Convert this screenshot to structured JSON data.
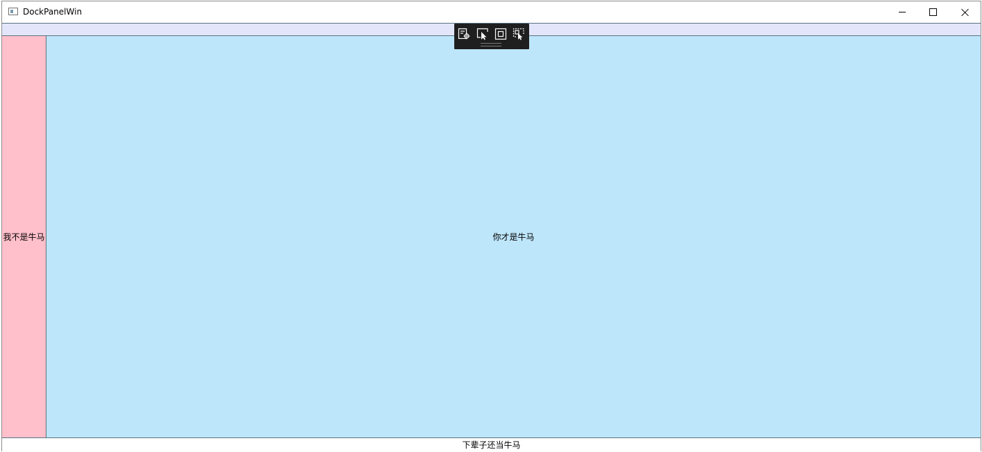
{
  "window": {
    "title": "DockPanelWin",
    "app_icon": "window-app-icon",
    "buttons": {
      "minimize": "minimize-icon",
      "maximize": "maximize-icon",
      "close": "close-icon"
    }
  },
  "dock_panel": {
    "top": {
      "text": "",
      "background": "#e3e6fa"
    },
    "left": {
      "text": "我不是牛马",
      "background": "#ffc0cb"
    },
    "fill": {
      "text": "你才是牛马",
      "background": "#bee6fa"
    },
    "bottom": {
      "text": "下辈子还当牛马",
      "background": "#ffffff"
    }
  },
  "debug_toolbar": {
    "items": [
      {
        "icon": "live-visual-tree-icon"
      },
      {
        "icon": "select-element-icon"
      },
      {
        "icon": "display-layout-adorners-icon"
      },
      {
        "icon": "track-focused-element-icon"
      }
    ],
    "background": "#1f1f1f"
  },
  "colors": {
    "border": "#5a7180",
    "window_border": "#8a8a8a"
  }
}
